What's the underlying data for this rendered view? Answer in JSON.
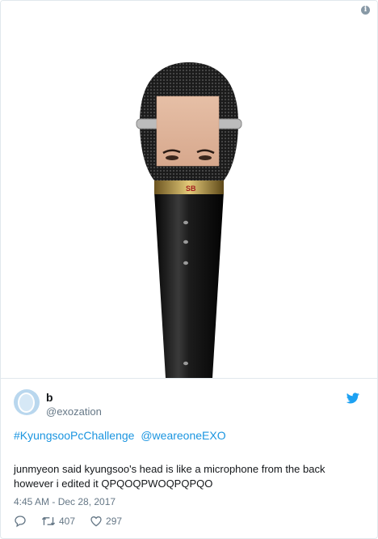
{
  "tweet": {
    "author": {
      "name": "b",
      "handle": "@exozation"
    },
    "hashtags": [
      "#KyungsooPcChallenge",
      "@weareoneEXO"
    ],
    "text_lines": [
      "junmyeon said kyungsoo's head is like a microphone from the back",
      "however i edited it QPQOQPWOQPQPQO"
    ],
    "timestamp": "4:45 AM - Dec 28, 2017",
    "actions": {
      "retweets": "407",
      "likes": "297"
    }
  },
  "media": {
    "mic_label": "SB"
  },
  "icons": {
    "info": "info-icon",
    "brand": "twitter-bird-icon",
    "reply": "reply-icon",
    "retweet": "retweet-icon",
    "like": "heart-icon"
  },
  "colors": {
    "link": "#1b95e0",
    "brand": "#1da1f2",
    "muted": "#657786",
    "text": "#14171a"
  }
}
